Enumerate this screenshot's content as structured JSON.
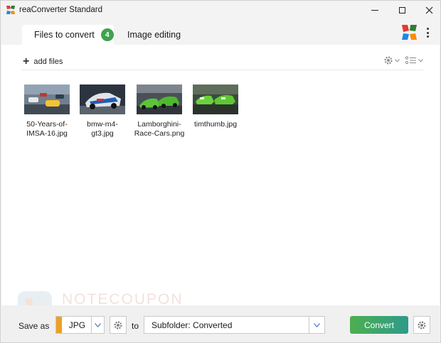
{
  "window": {
    "title": "reaConverter Standard"
  },
  "tabs": [
    {
      "label": "Files to convert",
      "count": "4"
    },
    {
      "label": "Image editing"
    }
  ],
  "toolbar": {
    "add_files_label": "add files"
  },
  "files": [
    {
      "caption_line1": "50-Years-of-",
      "caption_line2": "IMSA-16.jpg"
    },
    {
      "caption_line1": "bmw-m4-",
      "caption_line2": "gt3.jpg"
    },
    {
      "caption_line1": "Lamborghini-",
      "caption_line2": "Race-Cars.png"
    },
    {
      "caption_line1": "timthumb.jpg",
      "caption_line2": ""
    }
  ],
  "bottom": {
    "save_as_label": "Save as",
    "format": "JPG",
    "to_label": "to",
    "destination": "Subfolder: Converted",
    "convert_label": "Convert"
  },
  "watermark": {
    "text": "NOTECOUPON"
  },
  "colors": {
    "badge": "#3fa34d",
    "format_accent": "#f0a020",
    "convert_start": "#4caf50",
    "convert_end": "#2e9a8a"
  }
}
